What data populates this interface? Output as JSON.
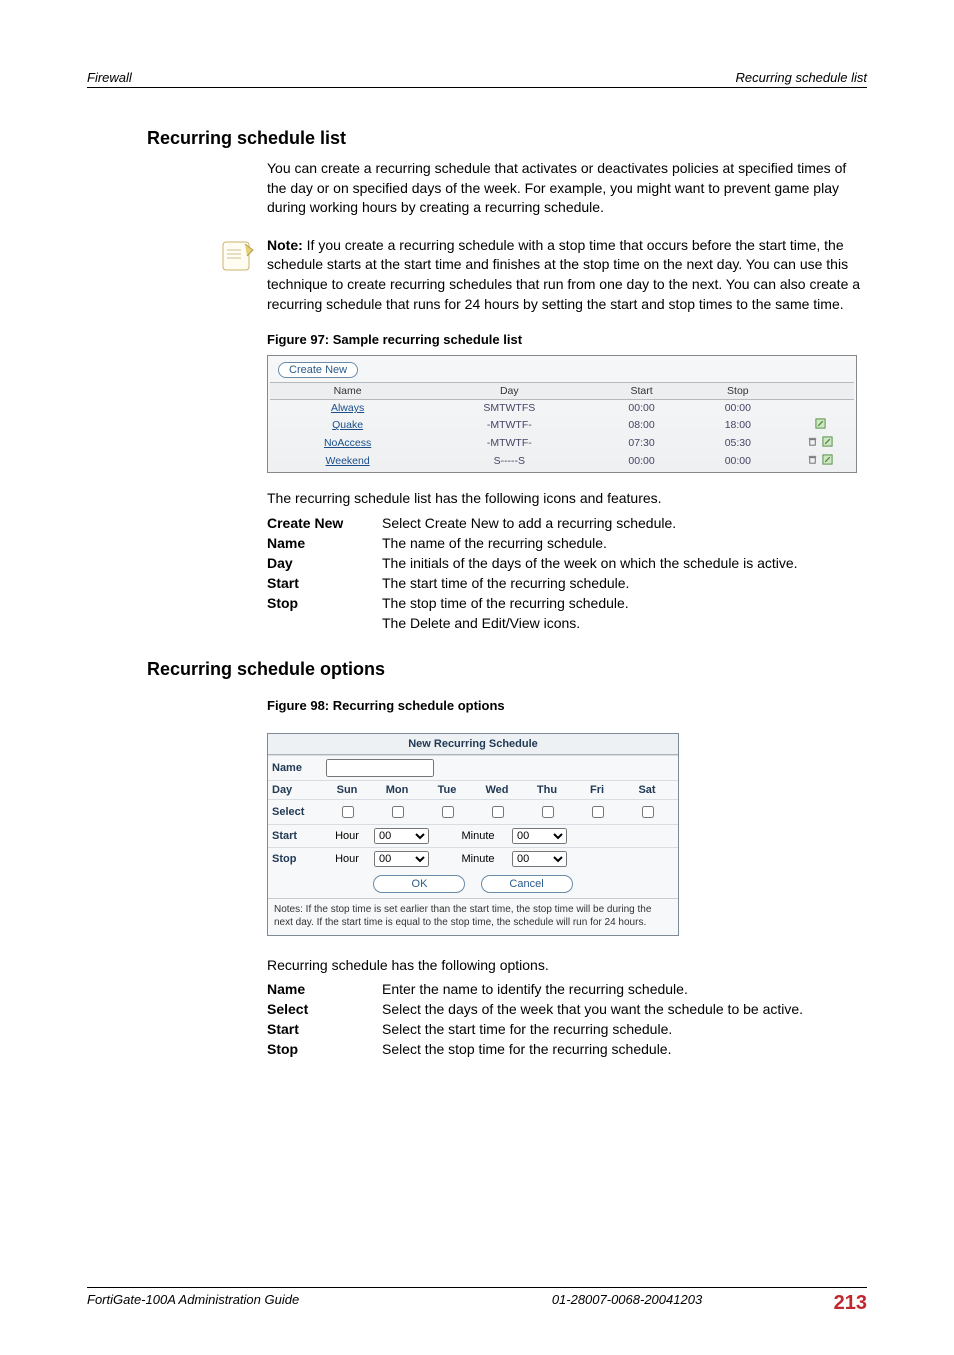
{
  "running_head": {
    "left": "Firewall",
    "right": "Recurring schedule list"
  },
  "section1": {
    "title": "Recurring schedule list",
    "intro": "You can create a recurring schedule that activates or deactivates policies at specified times of the day or on specified days of the week. For example, you might want to prevent game play during working hours by creating a recurring schedule.",
    "note_label": "Note:",
    "note_text": " If you create a recurring schedule with a stop time that occurs before the start time, the schedule starts at the start time and finishes at the stop time on the next day. You can use this technique to create recurring schedules that run from one day to the next. You can also create a recurring schedule that runs for 24 hours by setting the start and stop times to the same time.",
    "fig_caption": "Figure 97: Sample recurring schedule list",
    "create_new_btn": "Create New",
    "table": {
      "headers": [
        "Name",
        "Day",
        "Start",
        "Stop",
        ""
      ],
      "rows": [
        {
          "name": "Always",
          "day": "SMTWTFS",
          "start": "00:00",
          "stop": "00:00",
          "delete": false,
          "edit": false
        },
        {
          "name": "Quake",
          "day": "-MTWTF-",
          "start": "08:00",
          "stop": "18:00",
          "delete": false,
          "edit": true
        },
        {
          "name": "NoAccess",
          "day": "-MTWTF-",
          "start": "07:30",
          "stop": "05:30",
          "delete": true,
          "edit": true
        },
        {
          "name": "Weekend",
          "day": "S-----S",
          "start": "00:00",
          "stop": "00:00",
          "delete": true,
          "edit": true
        }
      ]
    },
    "after_table": "The recurring schedule list has the following icons and features.",
    "defs": [
      {
        "term": "Create New",
        "desc": "Select Create New to add a recurring schedule."
      },
      {
        "term": "Name",
        "desc": "The name of the recurring schedule."
      },
      {
        "term": "Day",
        "desc": "The initials of the days of the week on which the schedule is active."
      },
      {
        "term": "Start",
        "desc": "The start time of the recurring schedule."
      },
      {
        "term": "Stop",
        "desc": "The stop time of the recurring schedule."
      },
      {
        "term": "",
        "desc": "The Delete and Edit/View icons."
      }
    ]
  },
  "section2": {
    "title": "Recurring schedule options",
    "fig_caption": "Figure 98: Recurring schedule options",
    "form": {
      "title": "New Recurring Schedule",
      "labels": {
        "name": "Name",
        "day": "Day",
        "select": "Select",
        "start": "Start",
        "stop": "Stop",
        "hour": "Hour",
        "minute": "Minute"
      },
      "days": [
        "Sun",
        "Mon",
        "Tue",
        "Wed",
        "Thu",
        "Fri",
        "Sat"
      ],
      "hour_options": [
        "00"
      ],
      "minute_options": [
        "00"
      ],
      "start_hour": "00",
      "start_minute": "00",
      "stop_hour": "00",
      "stop_minute": "00",
      "ok": "OK",
      "cancel": "Cancel",
      "notes": "Notes: If the stop time is set earlier than the start time, the stop time will be during the next day. If the start time is equal to the stop time, the schedule will run for 24 hours."
    },
    "after_fig": "Recurring schedule has the following options.",
    "defs": [
      {
        "term": "Name",
        "desc": "Enter the name to identify the recurring schedule."
      },
      {
        "term": "Select",
        "desc": "Select the days of the week that you want the schedule to be active."
      },
      {
        "term": "Start",
        "desc": "Select the start time for the recurring schedule."
      },
      {
        "term": "Stop",
        "desc": "Select the stop time for the recurring schedule."
      }
    ]
  },
  "footer": {
    "left": "FortiGate-100A Administration Guide",
    "center": "01-28007-0068-20041203",
    "page": "213"
  }
}
